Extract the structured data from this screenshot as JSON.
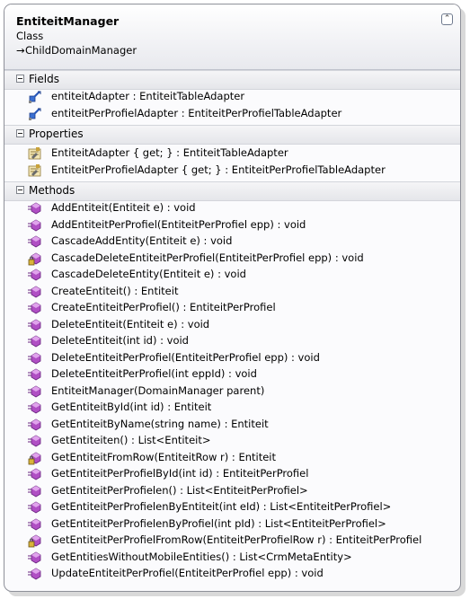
{
  "class": {
    "name": "EntiteitManager",
    "kind": "Class",
    "base_arrow": "→",
    "base": "ChildDomainManager",
    "collapse_glyph": "⌃"
  },
  "sections": {
    "fields": {
      "label": "Fields",
      "items": [
        {
          "text": "entiteitAdapter : EntiteitTableAdapter",
          "icon": "field-icon"
        },
        {
          "text": "entiteitPerProfielAdapter : EntiteitPerProfielTableAdapter",
          "icon": "field-icon"
        }
      ]
    },
    "properties": {
      "label": "Properties",
      "items": [
        {
          "text": "EntiteitAdapter { get; } : EntiteitTableAdapter",
          "icon": "property-icon"
        },
        {
          "text": "EntiteitPerProfielAdapter { get; } : EntiteitPerProfielTableAdapter",
          "icon": "property-icon"
        }
      ]
    },
    "methods": {
      "label": "Methods",
      "items": [
        {
          "text": "AddEntiteit(Entiteit e) : void",
          "icon": "method-icon"
        },
        {
          "text": "AddEntiteitPerProfiel(EntiteitPerProfiel epp) : void",
          "icon": "method-icon"
        },
        {
          "text": "CascadeAddEntity(Entiteit e) : void",
          "icon": "method-icon"
        },
        {
          "text": "CascadeDeleteEntiteitPerProfiel(EntiteitPerProfiel epp) : void",
          "icon": "private-method-icon"
        },
        {
          "text": "CascadeDeleteEntity(Entiteit e) : void",
          "icon": "method-icon"
        },
        {
          "text": "CreateEntiteit() : Entiteit",
          "icon": "method-icon"
        },
        {
          "text": "CreateEntiteitPerProfiel() : EntiteitPerProfiel",
          "icon": "method-icon"
        },
        {
          "text": "DeleteEntiteit(Entiteit e) : void",
          "icon": "method-icon"
        },
        {
          "text": "DeleteEntiteit(int id) : void",
          "icon": "method-icon"
        },
        {
          "text": "DeleteEntiteitPerProfiel(EntiteitPerProfiel epp) : void",
          "icon": "method-icon"
        },
        {
          "text": "DeleteEntiteitPerProfiel(int eppId) : void",
          "icon": "method-icon"
        },
        {
          "text": "EntiteitManager(DomainManager parent)",
          "icon": "method-icon"
        },
        {
          "text": "GetEntiteitById(int id) : Entiteit",
          "icon": "method-icon"
        },
        {
          "text": "GetEntiteitByName(string name) : Entiteit",
          "icon": "method-icon"
        },
        {
          "text": "GetEntiteiten() : List<Entiteit>",
          "icon": "method-icon"
        },
        {
          "text": "GetEntiteitFromRow(EntiteitRow r) : Entiteit",
          "icon": "private-method-icon"
        },
        {
          "text": "GetEntiteitPerProfielById(int id) : EntiteitPerProfiel",
          "icon": "method-icon"
        },
        {
          "text": "GetEntiteitPerProfielen() : List<EntiteitPerProfiel>",
          "icon": "method-icon"
        },
        {
          "text": "GetEntiteitPerProfielenByEntiteit(int eId) : List<EntiteitPerProfiel>",
          "icon": "method-icon"
        },
        {
          "text": "GetEntiteitPerProfielenByProfiel(int pId) : List<EntiteitPerProfiel>",
          "icon": "method-icon"
        },
        {
          "text": "GetEntiteitPerProfielFromRow(EntiteitPerProfielRow r) : EntiteitPerProfiel",
          "icon": "private-method-icon"
        },
        {
          "text": "GetEntitiesWithoutMobileEntities() : List<CrmMetaEntity>",
          "icon": "method-icon"
        },
        {
          "text": "UpdateEntiteitPerProfiel(EntiteitPerProfiel epp) : void",
          "icon": "method-icon"
        }
      ]
    }
  }
}
